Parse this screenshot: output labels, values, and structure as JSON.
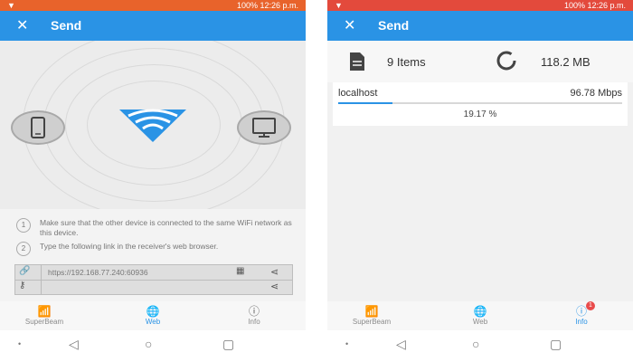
{
  "left": {
    "status": {
      "right_text": "100% 12:26 p.m."
    },
    "appbar": {
      "close_label": "✕",
      "title": "Send"
    },
    "instructions": [
      {
        "number": "1",
        "text": "Make sure that the other device is connected to the same WiFi network as this device."
      },
      {
        "number": "2",
        "text": "Type the following link in the receiver's web browser."
      }
    ],
    "link": {
      "url": "https://192.168.77.240:60936"
    },
    "bottom_nav": [
      {
        "label": "SuperBeam",
        "icon": "wifi-icon",
        "active": false
      },
      {
        "label": "Web",
        "icon": "globe-icon",
        "active": true
      },
      {
        "label": "Info",
        "icon": "info-icon",
        "active": false
      }
    ]
  },
  "right": {
    "status": {
      "right_text": "100% 12:26 p.m."
    },
    "appbar": {
      "close_label": "✕",
      "title": "Send"
    },
    "summary": {
      "items": "9 Items",
      "size": "118.2 MB"
    },
    "transfer": {
      "host": "localhost",
      "speed": "96.78 Mbps",
      "percent_text": "19.17 %",
      "progress": 0.1917
    },
    "bottom_nav": [
      {
        "label": "SuperBeam",
        "icon": "wifi-icon",
        "active": false
      },
      {
        "label": "Web",
        "icon": "globe-icon",
        "active": false
      },
      {
        "label": "Info",
        "icon": "info-icon",
        "active": true,
        "badge": "1"
      }
    ]
  },
  "colors": {
    "accent": "#2a93e5",
    "status_left": "#e8632b",
    "status_right": "#e34a3c"
  }
}
